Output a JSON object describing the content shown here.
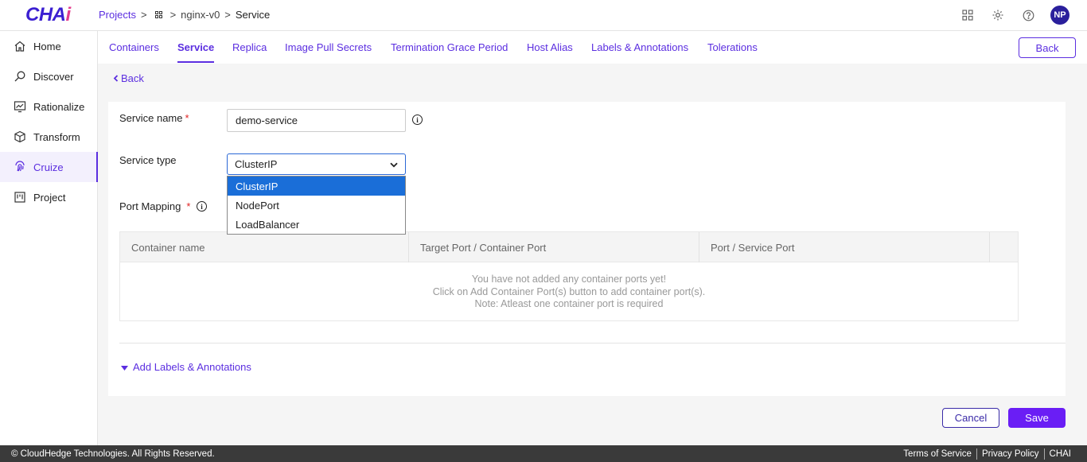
{
  "app": {
    "logo": "CHA",
    "logo_accent": "i"
  },
  "breadcrumb": {
    "projects": "Projects",
    "sep": ">",
    "project": "nginx-v0",
    "current": "Service"
  },
  "user": {
    "initials": "NP"
  },
  "sidebar": {
    "items": [
      {
        "label": "Home"
      },
      {
        "label": "Discover"
      },
      {
        "label": "Rationalize"
      },
      {
        "label": "Transform"
      },
      {
        "label": "Cruize"
      },
      {
        "label": "Project"
      }
    ]
  },
  "tabs": [
    {
      "label": "Containers"
    },
    {
      "label": "Service"
    },
    {
      "label": "Replica"
    },
    {
      "label": "Image Pull Secrets"
    },
    {
      "label": "Termination Grace Period"
    },
    {
      "label": "Host Alias"
    },
    {
      "label": "Labels & Annotations"
    },
    {
      "label": "Tolerations"
    }
  ],
  "header": {
    "back_button": "Back"
  },
  "content": {
    "back_link": "Back"
  },
  "form": {
    "service_name_label": "Service name",
    "required_mark": "*",
    "service_name_value": "demo-service",
    "service_type_label": "Service type",
    "service_type_value": "ClusterIP",
    "service_type_options": [
      "ClusterIP",
      "NodePort",
      "LoadBalancer"
    ],
    "port_mapping_label": "Port Mapping"
  },
  "table": {
    "headers": [
      "Container name",
      "Target Port / Container Port",
      "Port / Service Port",
      ""
    ],
    "empty_lines": [
      "You have not added any container ports yet!",
      "Click on Add Container Port(s) button to add container port(s).",
      "Note: Atleast one container port is required"
    ]
  },
  "add_labels": "Add Labels & Annotations",
  "actions": {
    "cancel": "Cancel",
    "save": "Save"
  },
  "footer": {
    "copyright": "© CloudHedge Technologies. All Rights Reserved.",
    "links": [
      "Terms of Service",
      "Privacy Policy",
      "CHAI"
    ]
  },
  "colors": {
    "accent": "#5b2ee0",
    "save": "#6a1ef5",
    "footer": "#3a3a3a",
    "selected_option": "#1a6ed8"
  }
}
